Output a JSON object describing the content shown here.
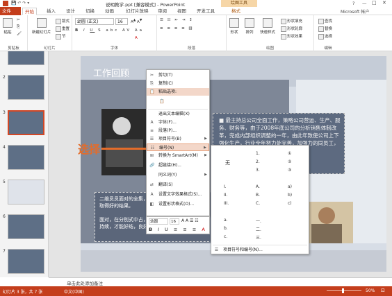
{
  "window": {
    "title": "说明教学.ppt [兼容模式] - PowerPoint",
    "context_tab": "绘图工具",
    "account": "Microsoft 帐户"
  },
  "ribbon": {
    "tabs": [
      "文件",
      "开始",
      "插入",
      "设计",
      "切换",
      "动画",
      "幻灯片放映",
      "审阅",
      "视图",
      "开发工具",
      "格式"
    ],
    "groups": {
      "clipboard": {
        "label": "剪贴板",
        "paste": "粘贴"
      },
      "slides": {
        "label": "幻灯片",
        "new_slide": "新建幻灯片",
        "layout": "版式",
        "reset": "重置",
        "section": "节"
      },
      "font": {
        "label": "字体",
        "font_name": "幼圆 (正文)",
        "font_size": "16"
      },
      "paragraph": {
        "label": "段落"
      },
      "drawing": {
        "label": "绘图",
        "shapes": "形状",
        "arrange": "排列",
        "quick_styles": "快速样式",
        "fill": "形状填充",
        "outline": "形状轮廓",
        "effects": "形状效果"
      },
      "editing": {
        "label": "编辑",
        "find": "查找",
        "replace": "替换",
        "select": "选择"
      }
    }
  },
  "thumbnails": [
    {
      "num": "2"
    },
    {
      "num": "3"
    },
    {
      "num": "4"
    },
    {
      "num": "5"
    },
    {
      "num": "6"
    },
    {
      "num": "7"
    }
  ],
  "slide": {
    "title": "工作回顾",
    "right_text": "■ 最主持总公司全面工作，策略公司营运、生产、服务、财务等，由于2008年底公司的分析销售体制改革，完成内部组织调整的一年，由此年致使公司上下强化生产，行业全年努力处完善，加强力的同员工，业持续发展",
    "left_bullets": [
      "二维员员面对的全集，才能取得好的结果。",
      "面对，在分别式中占，不容持续，才能好结，良好。"
    ],
    "annotation": "选择"
  },
  "context_menu": {
    "items": [
      {
        "label": "剪切(T)",
        "icon": "✂"
      },
      {
        "label": "复制(C)",
        "icon": "⎘"
      },
      {
        "label": "粘贴选项:",
        "icon": "📋"
      },
      {
        "label": "",
        "icon": "📋"
      },
      {
        "label": "退出文本编辑(X)",
        "icon": ""
      },
      {
        "label": "字体(F)...",
        "icon": "A"
      },
      {
        "label": "段落(P)...",
        "icon": "≡"
      },
      {
        "label": "项目符号(B)",
        "icon": "☰"
      },
      {
        "label": "编号(N)",
        "icon": "☷"
      },
      {
        "label": "转换为 SmartArt(M)",
        "icon": "⊞"
      },
      {
        "label": "超链接(H)...",
        "icon": "🔗"
      },
      {
        "label": "同义词(Y)",
        "icon": ""
      },
      {
        "label": "翻译(S)",
        "icon": "⇄"
      },
      {
        "label": "设置文字效果格式(S)...",
        "icon": "A"
      },
      {
        "label": "设置形状格式(O)...",
        "icon": "◧"
      }
    ],
    "mini_toolbar": {
      "font": "幼圆",
      "size": "16"
    }
  },
  "numbering_submenu": {
    "none_label": "无",
    "formats": [
      [
        "1.",
        "2.",
        "3."
      ],
      [
        "①",
        "②",
        "③"
      ],
      [
        "I.",
        "II.",
        "III."
      ],
      [
        "A.",
        "B.",
        "C."
      ],
      [
        "a)",
        "b)",
        "c)"
      ],
      [
        "a.",
        "b.",
        "c."
      ],
      [
        "一.",
        "二.",
        "三."
      ]
    ],
    "footer": "项目符号和编号(N)..."
  },
  "notes": {
    "placeholder": "单击此处添加备注"
  },
  "status": {
    "slide_info": "幻灯片 3 张，共 7 张",
    "language": "中文(中国)",
    "zoom": "50%"
  }
}
